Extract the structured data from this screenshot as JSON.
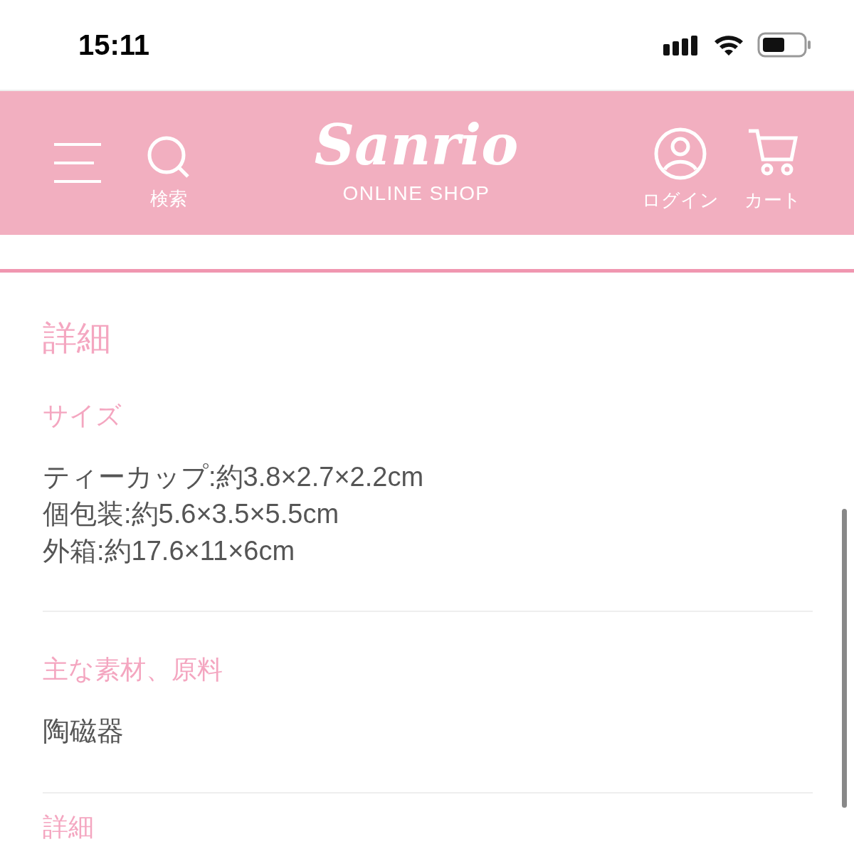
{
  "status_bar": {
    "time": "15:11"
  },
  "header": {
    "search_label": "検索",
    "logo": "Sanrio",
    "logo_sub": "ONLINE SHOP",
    "login_label": "ログイン",
    "cart_label": "カート"
  },
  "section_title": "詳細",
  "details": [
    {
      "heading": "サイズ",
      "lines": [
        "ティーカップ:約3.8×2.7×2.2cm",
        "個包装:約5.6×3.5×5.5cm",
        "外箱:約17.6×11×6cm"
      ]
    },
    {
      "heading": "主な素材、原料",
      "lines": [
        "陶磁器"
      ]
    }
  ],
  "next_heading": "詳細"
}
